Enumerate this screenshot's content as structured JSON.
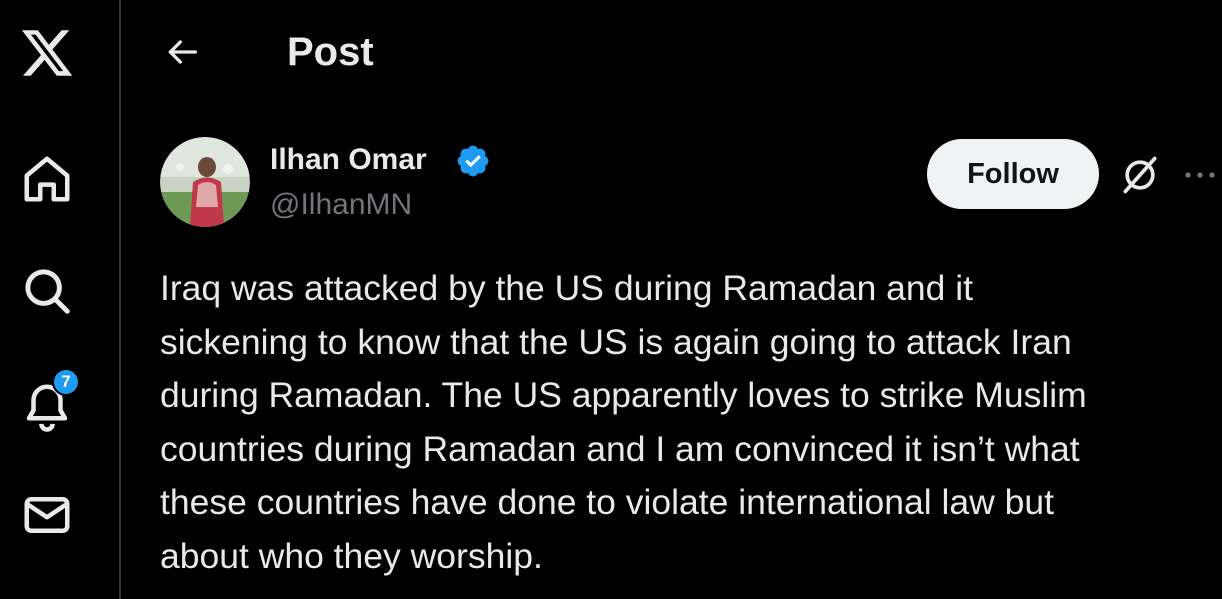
{
  "sidebar": {
    "items": [
      {
        "name": "x-logo",
        "icon": "x-logo-icon"
      },
      {
        "name": "home",
        "icon": "home-icon"
      },
      {
        "name": "explore",
        "icon": "search-icon"
      },
      {
        "name": "notifications",
        "icon": "bell-icon",
        "badge": "7"
      },
      {
        "name": "messages",
        "icon": "mail-icon"
      }
    ],
    "notification_count": "7"
  },
  "header": {
    "back_icon": "arrow-left-icon",
    "title": "Post"
  },
  "post": {
    "author": {
      "name": "Ilhan Omar",
      "handle": "@IlhanMN",
      "verified": true,
      "verified_color": "#1d9bf0"
    },
    "follow_label": "Follow",
    "grok_icon": "grok-icon",
    "more_icon": "more-horizontal-icon",
    "text": "Iraq was attacked by the US during Ramadan and it\nsickening to know that the US is again going to attack Iran\nduring Ramadan.  The US apparently loves to strike Muslim\ncountries during Ramadan and I am convinced it isn’t what\nthese countries have done to violate international law but\nabout who they worship."
  },
  "colors": {
    "background": "#000000",
    "text_primary": "#e7e9ea",
    "text_secondary": "#71767b",
    "accent": "#1d9bf0",
    "follow_bg": "#eff3f4",
    "divider": "#2f3336"
  }
}
